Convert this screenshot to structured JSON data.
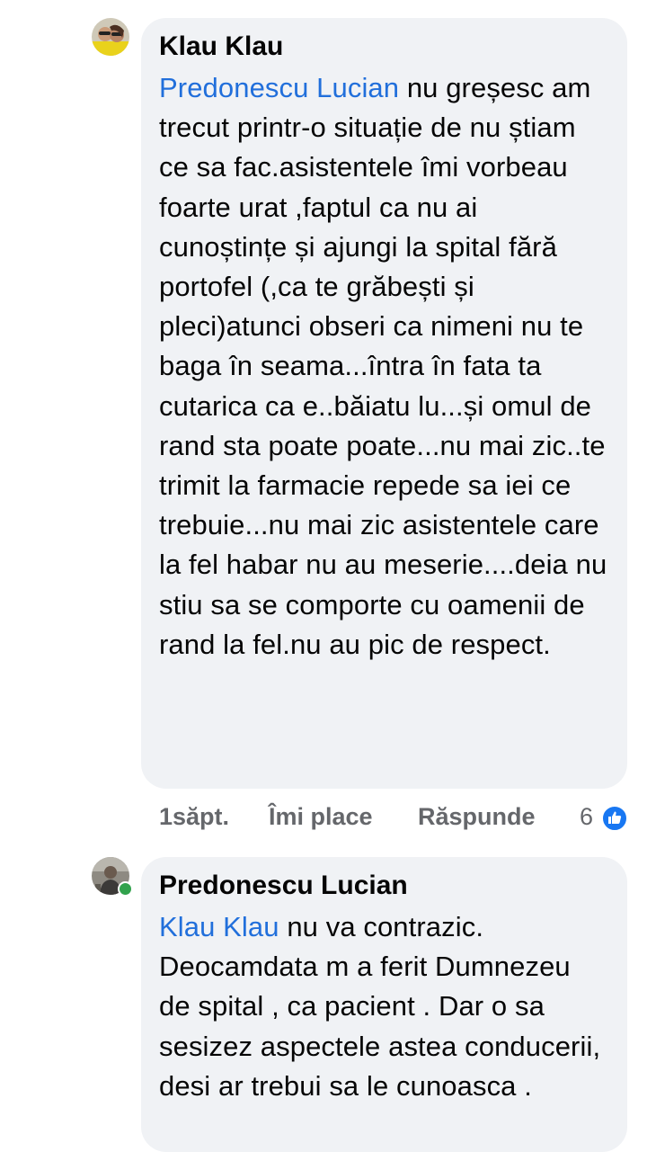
{
  "top_fragment": "·",
  "comments": [
    {
      "author": "Klau Klau",
      "mention": "Predonescu Lucian",
      "text": " nu greșesc am trecut printr-o situație de nu știam ce sa fac.asistentele îmi vorbeau foarte urat ,faptul ca nu ai cunoștințe și ajungi la spital fără portofel (,ca te grăbești și pleci)atunci obseri ca nimeni nu te baga în seama...întra în fata ta cutarica ca e..băiatu lu...și omul de rand sta poate poate...nu mai zic..te trimit la farmacie repede sa iei ce trebuie...nu mai zic asistentele care la fel habar nu au meserie....deia nu stiu sa se comporte cu oamenii de rand la fel.nu au pic de respect.",
      "time": "1săpt.",
      "like_label": "Îmi place",
      "reply_label": "Răspunde",
      "reaction_count": "6",
      "reaction_icon": "like-thumb-icon"
    },
    {
      "author": "Predonescu Lucian",
      "mention": "Klau Klau",
      "text": " nu va contrazic. Deocamdata m a ferit Dumnezeu de spital , ca pacient . Dar o sa sesizez aspectele astea conducerii, desi ar trebui sa le cunoasca ."
    }
  ],
  "colors": {
    "bubble": "#f0f2f5",
    "mention": "#216fdb",
    "meta": "#65676b",
    "like_badge": "#1877f2",
    "online": "#31a24c"
  }
}
